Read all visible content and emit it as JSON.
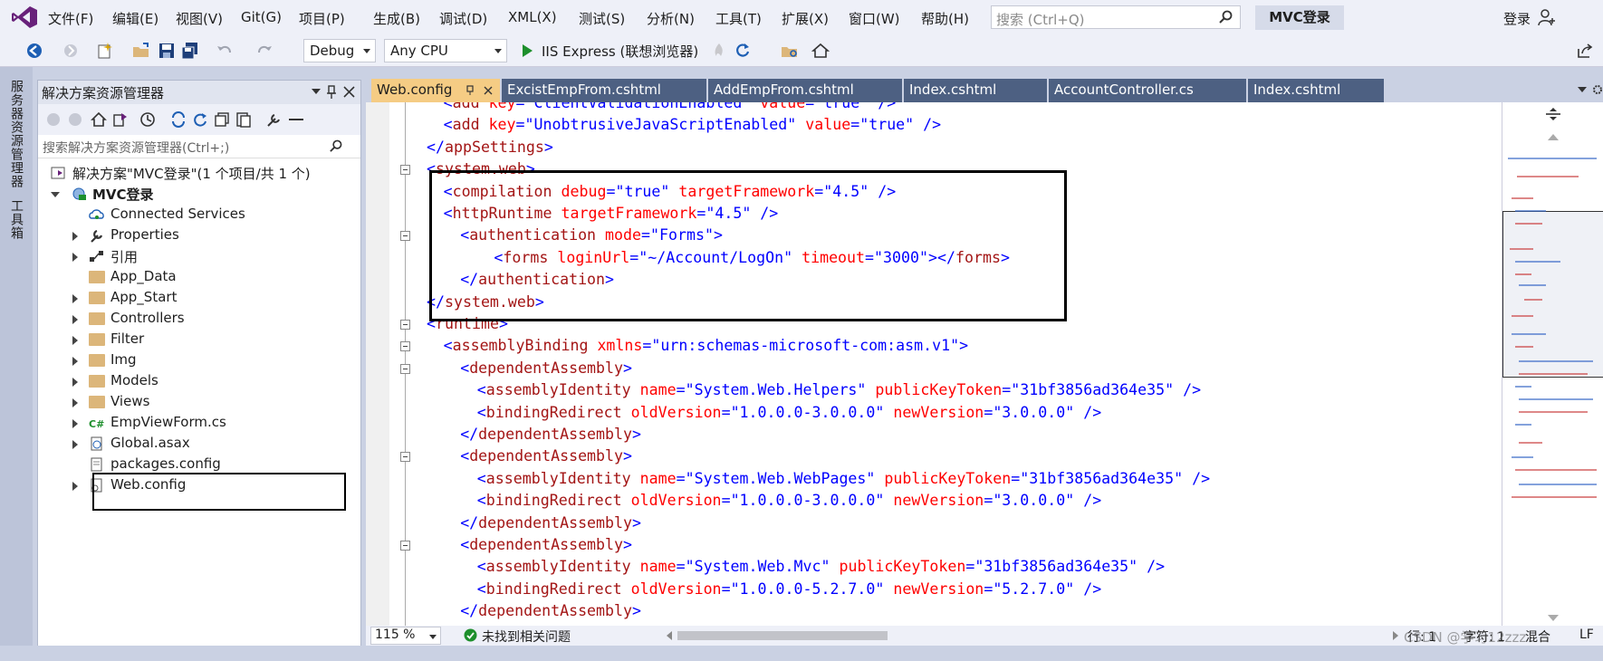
{
  "menu": [
    "文件(F)",
    "编辑(E)",
    "视图(V)",
    "Git(G)",
    "项目(P)",
    "生成(B)",
    "调试(D)",
    "XML(X)",
    "测试(S)",
    "分析(N)",
    "工具(T)",
    "扩展(X)",
    "窗口(W)",
    "帮助(H)"
  ],
  "search": {
    "placeholder": "搜索 (Ctrl+Q)"
  },
  "solution_name": "MVC登录",
  "signin": "登录",
  "toolbar": {
    "config": "Debug",
    "platform": "Any CPU",
    "run": "IIS Express (联想浏览器)"
  },
  "left_strip": {
    "server_explorer": "服务器资源管理器",
    "toolbox": "工具箱"
  },
  "solution_explorer": {
    "title": "解决方案资源管理器",
    "search_placeholder": "搜索解决方案资源管理器(Ctrl+;)",
    "solution": "解决方案\"MVC登录\"(1 个项目/共 1 个)",
    "project": "MVC登录",
    "items": [
      "Connected Services",
      "Properties",
      "引用",
      "App_Data",
      "App_Start",
      "Controllers",
      "Filter",
      "Img",
      "Models",
      "Views",
      "EmpViewForm.cs",
      "Global.asax",
      "packages.config",
      "Web.config"
    ]
  },
  "tabs": [
    "Web.config",
    "ExcistEmpFrom.cshtml",
    "AddEmpFrom.cshtml",
    "Index.cshtml",
    "AccountController.cs",
    "Index.cshtml"
  ],
  "code": [
    {
      "i": 1,
      "p": [
        [
          "b",
          "<"
        ],
        [
          "t",
          "add"
        ],
        [
          "a",
          " key"
        ],
        [
          "b",
          "="
        ],
        [
          "s",
          "\"ClientValidationEnabled\""
        ],
        [
          "a",
          " value"
        ],
        [
          "b",
          "="
        ],
        [
          "s",
          "\"true\""
        ],
        [
          "b",
          " />"
        ]
      ]
    },
    {
      "i": 1,
      "p": [
        [
          "b",
          "<"
        ],
        [
          "t",
          "add"
        ],
        [
          "a",
          " key"
        ],
        [
          "b",
          "="
        ],
        [
          "s",
          "\"UnobtrusiveJavaScriptEnabled\""
        ],
        [
          "a",
          " value"
        ],
        [
          "b",
          "="
        ],
        [
          "s",
          "\"true\""
        ],
        [
          "b",
          " />"
        ]
      ]
    },
    {
      "i": 0,
      "p": [
        [
          "b",
          "</"
        ],
        [
          "t",
          "appSettings"
        ],
        [
          "b",
          ">"
        ]
      ]
    },
    {
      "i": 0,
      "p": [
        [
          "b",
          "<"
        ],
        [
          "t",
          "system.web"
        ],
        [
          "b",
          ">"
        ]
      ]
    },
    {
      "i": 1,
      "p": [
        [
          "b",
          "<"
        ],
        [
          "t",
          "compilation"
        ],
        [
          "a",
          " debug"
        ],
        [
          "b",
          "="
        ],
        [
          "s",
          "\"true\""
        ],
        [
          "a",
          " targetFramework"
        ],
        [
          "b",
          "="
        ],
        [
          "s",
          "\"4.5\""
        ],
        [
          "b",
          " />"
        ]
      ]
    },
    {
      "i": 1,
      "p": [
        [
          "b",
          "<"
        ],
        [
          "t",
          "httpRuntime"
        ],
        [
          "a",
          " targetFramework"
        ],
        [
          "b",
          "="
        ],
        [
          "s",
          "\"4.5\""
        ],
        [
          "b",
          " />"
        ]
      ]
    },
    {
      "i": 2,
      "p": [
        [
          "b",
          "<"
        ],
        [
          "t",
          "authentication"
        ],
        [
          "a",
          " mode"
        ],
        [
          "b",
          "="
        ],
        [
          "s",
          "\"Forms\""
        ],
        [
          "b",
          ">"
        ]
      ]
    },
    {
      "i": 4,
      "p": [
        [
          "b",
          "<"
        ],
        [
          "t",
          "forms"
        ],
        [
          "a",
          " loginUrl"
        ],
        [
          "b",
          "="
        ],
        [
          "s",
          "\"~/Account/LogOn\""
        ],
        [
          "a",
          " timeout"
        ],
        [
          "b",
          "="
        ],
        [
          "s",
          "\"3000\""
        ],
        [
          "b",
          "></"
        ],
        [
          "t",
          "forms"
        ],
        [
          "b",
          ">"
        ]
      ]
    },
    {
      "i": 2,
      "p": [
        [
          "b",
          "</"
        ],
        [
          "t",
          "authentication"
        ],
        [
          "b",
          ">"
        ]
      ]
    },
    {
      "i": 0,
      "p": [
        [
          "b",
          "</"
        ],
        [
          "t",
          "system.web"
        ],
        [
          "b",
          ">"
        ]
      ]
    },
    {
      "i": 0,
      "p": [
        [
          "b",
          "<"
        ],
        [
          "t",
          "runtime"
        ],
        [
          "b",
          ">"
        ]
      ]
    },
    {
      "i": 1,
      "p": [
        [
          "b",
          "<"
        ],
        [
          "t",
          "assemblyBinding"
        ],
        [
          "a",
          " xmlns"
        ],
        [
          "b",
          "="
        ],
        [
          "s",
          "\"urn:schemas-microsoft-com:asm.v1\""
        ],
        [
          "b",
          ">"
        ]
      ]
    },
    {
      "i": 2,
      "p": [
        [
          "b",
          "<"
        ],
        [
          "t",
          "dependentAssembly"
        ],
        [
          "b",
          ">"
        ]
      ]
    },
    {
      "i": 3,
      "p": [
        [
          "b",
          "<"
        ],
        [
          "t",
          "assemblyIdentity"
        ],
        [
          "a",
          " name"
        ],
        [
          "b",
          "="
        ],
        [
          "s",
          "\"System.Web.Helpers\""
        ],
        [
          "a",
          " publicKeyToken"
        ],
        [
          "b",
          "="
        ],
        [
          "s",
          "\"31bf3856ad364e35\""
        ],
        [
          "b",
          " />"
        ]
      ]
    },
    {
      "i": 3,
      "p": [
        [
          "b",
          "<"
        ],
        [
          "t",
          "bindingRedirect"
        ],
        [
          "a",
          " oldVersion"
        ],
        [
          "b",
          "="
        ],
        [
          "s",
          "\"1.0.0.0-3.0.0.0\""
        ],
        [
          "a",
          " newVersion"
        ],
        [
          "b",
          "="
        ],
        [
          "s",
          "\"3.0.0.0\""
        ],
        [
          "b",
          " />"
        ]
      ]
    },
    {
      "i": 2,
      "p": [
        [
          "b",
          "</"
        ],
        [
          "t",
          "dependentAssembly"
        ],
        [
          "b",
          ">"
        ]
      ]
    },
    {
      "i": 2,
      "p": [
        [
          "b",
          "<"
        ],
        [
          "t",
          "dependentAssembly"
        ],
        [
          "b",
          ">"
        ]
      ]
    },
    {
      "i": 3,
      "p": [
        [
          "b",
          "<"
        ],
        [
          "t",
          "assemblyIdentity"
        ],
        [
          "a",
          " name"
        ],
        [
          "b",
          "="
        ],
        [
          "s",
          "\"System.Web.WebPages\""
        ],
        [
          "a",
          " publicKeyToken"
        ],
        [
          "b",
          "="
        ],
        [
          "s",
          "\"31bf3856ad364e35\""
        ],
        [
          "b",
          " />"
        ]
      ]
    },
    {
      "i": 3,
      "p": [
        [
          "b",
          "<"
        ],
        [
          "t",
          "bindingRedirect"
        ],
        [
          "a",
          " oldVersion"
        ],
        [
          "b",
          "="
        ],
        [
          "s",
          "\"1.0.0.0-3.0.0.0\""
        ],
        [
          "a",
          " newVersion"
        ],
        [
          "b",
          "="
        ],
        [
          "s",
          "\"3.0.0.0\""
        ],
        [
          "b",
          " />"
        ]
      ]
    },
    {
      "i": 2,
      "p": [
        [
          "b",
          "</"
        ],
        [
          "t",
          "dependentAssembly"
        ],
        [
          "b",
          ">"
        ]
      ]
    },
    {
      "i": 2,
      "p": [
        [
          "b",
          "<"
        ],
        [
          "t",
          "dependentAssembly"
        ],
        [
          "b",
          ">"
        ]
      ]
    },
    {
      "i": 3,
      "p": [
        [
          "b",
          "<"
        ],
        [
          "t",
          "assemblyIdentity"
        ],
        [
          "a",
          " name"
        ],
        [
          "b",
          "="
        ],
        [
          "s",
          "\"System.Web.Mvc\""
        ],
        [
          "a",
          " publicKeyToken"
        ],
        [
          "b",
          "="
        ],
        [
          "s",
          "\"31bf3856ad364e35\""
        ],
        [
          "b",
          " />"
        ]
      ]
    },
    {
      "i": 3,
      "p": [
        [
          "b",
          "<"
        ],
        [
          "t",
          "bindingRedirect"
        ],
        [
          "a",
          " oldVersion"
        ],
        [
          "b",
          "="
        ],
        [
          "s",
          "\"1.0.0.0-5.2.7.0\""
        ],
        [
          "a",
          " newVersion"
        ],
        [
          "b",
          "="
        ],
        [
          "s",
          "\"5.2.7.0\""
        ],
        [
          "b",
          " />"
        ]
      ]
    },
    {
      "i": 2,
      "p": [
        [
          "b",
          "</"
        ],
        [
          "t",
          "dependentAssembly"
        ],
        [
          "b",
          ">"
        ]
      ]
    }
  ],
  "status": {
    "zoom": "115 %",
    "issues": "未找到相关问题",
    "line": "行: 1",
    "char": "字符: 1",
    "mixed": "混合",
    "eol": "LF",
    "watermark": "CSDN @学习12zzz"
  },
  "colors": {
    "accent": "#68217a",
    "tab_active": "#f5cc84",
    "tab_inactive": "#4d6082"
  }
}
